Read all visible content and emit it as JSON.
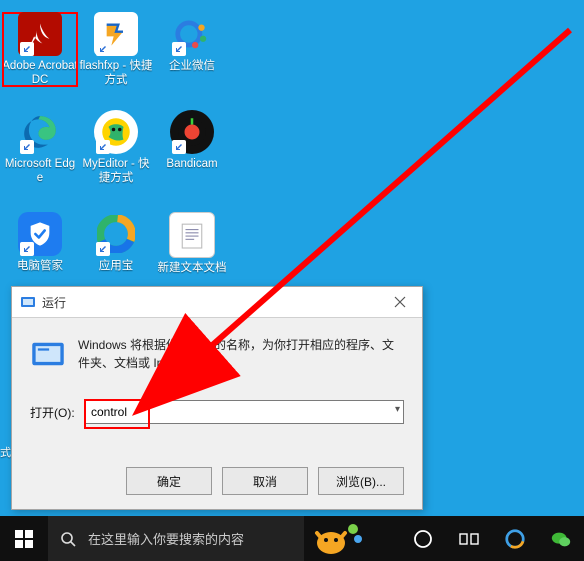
{
  "desktop": {
    "icons": [
      {
        "name": "adobe-acrobat",
        "label": "Adobe Acrobat DC"
      },
      {
        "name": "flashfxp",
        "label": "flashfxp - 快捷方式"
      },
      {
        "name": "qiye-weixin",
        "label": "企业微信"
      },
      {
        "name": "ms-edge",
        "label": "Microsoft Edge"
      },
      {
        "name": "myeditor",
        "label": "MyEditor - 快捷方式"
      },
      {
        "name": "bandicam",
        "label": "Bandicam"
      },
      {
        "name": "pcmanager",
        "label": "电脑管家"
      },
      {
        "name": "yingyongbao",
        "label": "应用宝"
      },
      {
        "name": "new-txt",
        "label": "新建文本文档"
      }
    ]
  },
  "run_dialog": {
    "title": "运行",
    "description": "Windows 将根据你所输入的名称，为你打开相应的程序、文件夹、文档或 Internet 资源。",
    "open_label": "打开(O):",
    "input_value": "control",
    "buttons": {
      "ok": "确定",
      "cancel": "取消",
      "browse": "浏览(B)..."
    }
  },
  "taskbar": {
    "search_placeholder": "在这里输入你要搜索的内容"
  },
  "edge_fragment": "式"
}
